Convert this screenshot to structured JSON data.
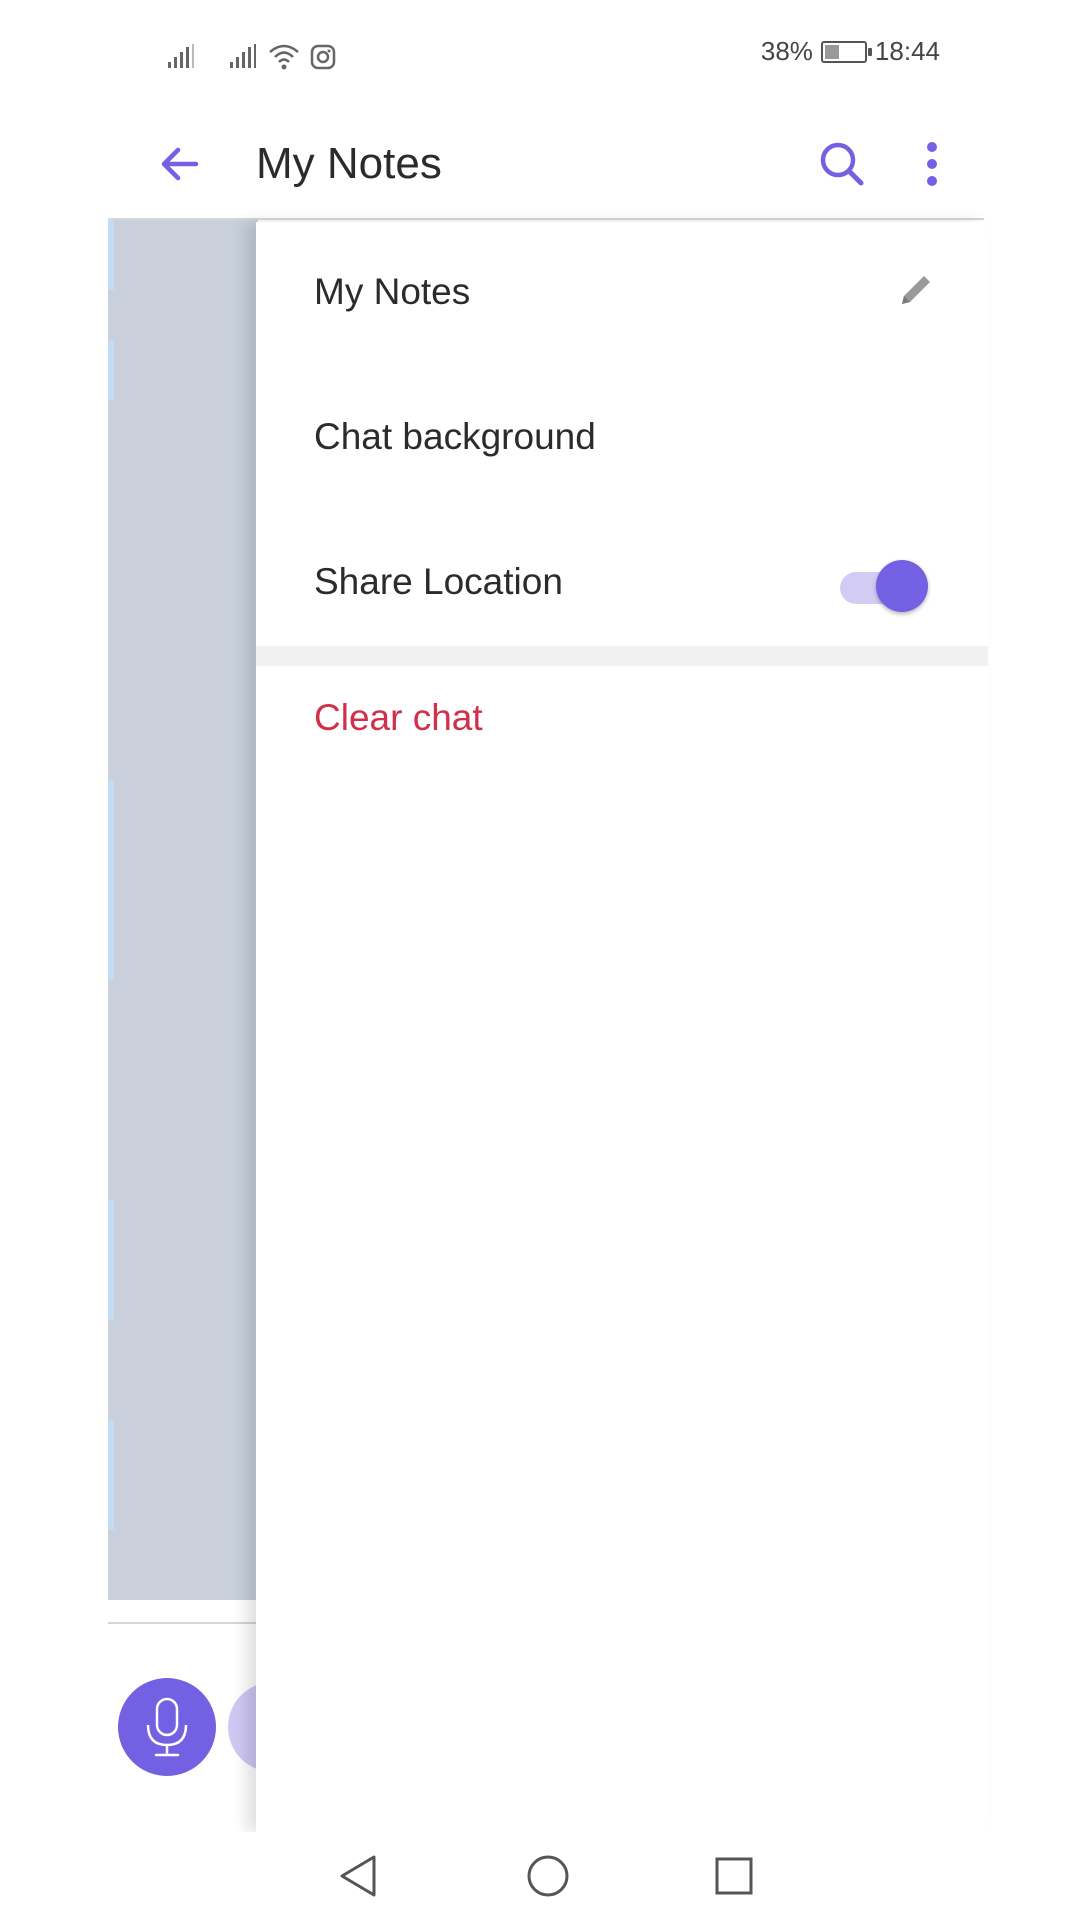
{
  "status_bar": {
    "battery_text": "38%",
    "battery_level": 0.38,
    "time": "18:44",
    "icons": [
      "signal-icon",
      "signal-icon",
      "wifi-icon",
      "instagram-icon",
      "battery-icon"
    ]
  },
  "app_bar": {
    "title": "My Notes",
    "icons": [
      "back-arrow-icon",
      "search-icon",
      "more-vertical-icon"
    ]
  },
  "drawer": {
    "items": [
      {
        "label": "My Notes",
        "icon": "pencil-icon"
      },
      {
        "label": "Chat background"
      },
      {
        "label": "Share Location",
        "toggle_on": true
      }
    ],
    "clear_chat_label": "Clear chat"
  },
  "colors": {
    "accent": "#7360e2",
    "destructive": "#d1304a",
    "dim_overlay": "#c9d0db"
  },
  "nav_bar": {
    "icons": [
      "back-triangle-icon",
      "home-circle-icon",
      "recents-square-icon"
    ]
  }
}
